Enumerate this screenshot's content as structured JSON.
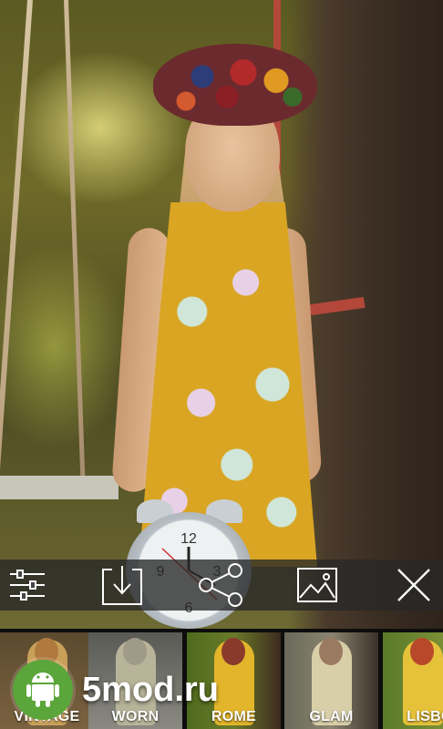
{
  "toolbar": {
    "actions": [
      {
        "id": "adjust",
        "icon": "sliders-icon"
      },
      {
        "id": "save",
        "icon": "download-icon"
      },
      {
        "id": "share",
        "icon": "share-icon"
      },
      {
        "id": "gallery",
        "icon": "image-icon"
      },
      {
        "id": "close",
        "icon": "close-icon"
      }
    ]
  },
  "filters": {
    "items": [
      {
        "label": "VINTAGE",
        "tone": "#6b5a3a"
      },
      {
        "label": "WORN",
        "tone": "#7a7a74"
      },
      {
        "label": "ROME",
        "tone": "#b58d2a"
      },
      {
        "label": "GLAM",
        "tone": "#9a8a6a"
      },
      {
        "label": "LISBO",
        "tone": "#c7a23a"
      }
    ]
  },
  "watermark": {
    "text": "5mod.ru",
    "badge_color": "#5aa63a"
  }
}
